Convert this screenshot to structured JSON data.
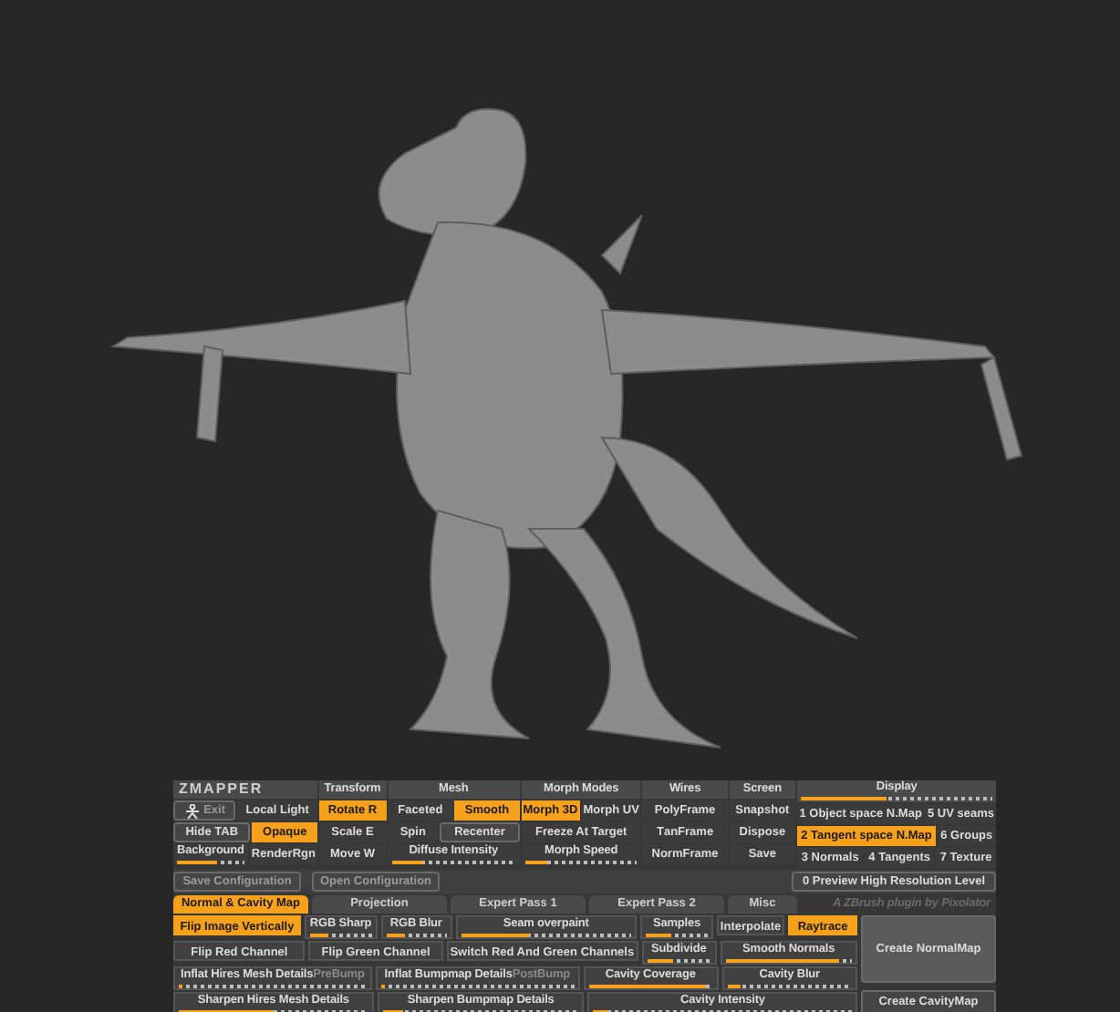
{
  "zmapper": {
    "groups": [
      {
        "header": {
          "kind": "logo",
          "label": "**Z**MAPPER"
        },
        "rows": [
          {
            "controls": [
              {
                "kind": "icon_action",
                "label": "Exit"
              },
              {
                "kind": "toggle",
                "label": "Local Light",
                "selected": false
              }
            ]
          },
          {
            "controls": [
              {
                "kind": "action",
                "label": "Hide **TAB**"
              },
              {
                "kind": "toggle",
                "label": "Opaque",
                "selected": true
              }
            ]
          },
          {
            "controls": [
              {
                "kind": "slider",
                "label": "Background",
                "level": 0.6
              },
              {
                "kind": "toggle",
                "label": "RenderRgn",
                "selected": false
              }
            ]
          }
        ]
      },
      {
        "header": {
          "kind": "tab",
          "label": "Transform"
        },
        "rows": [
          {
            "controls": [
              {
                "kind": "toggle",
                "label": "Rotate **R**",
                "selected": true
              }
            ]
          },
          {
            "controls": [
              {
                "kind": "toggle",
                "label": "Scale **E**",
                "selected": false
              }
            ]
          },
          {
            "controls": [
              {
                "kind": "toggle",
                "label": "Move **W**",
                "selected": false
              }
            ]
          }
        ]
      },
      {
        "header": {
          "kind": "tab",
          "label": "Mesh"
        },
        "rows": [
          {
            "controls": [
              {
                "kind": "toggle",
                "label": "Facete**d**",
                "selected": false
              },
              {
                "kind": "toggle",
                "label": "Smooth",
                "selected": true
              }
            ]
          },
          {
            "controls": [
              {
                "kind": "toggle",
                "label": "Spin",
                "selected": false
              },
              {
                "kind": "action",
                "label": "Recen**t**er"
              }
            ]
          },
          {
            "controls": [
              {
                "kind": "slider",
                "label": "Diffuse Intensity",
                "level": 0.25
              }
            ]
          }
        ]
      },
      {
        "header": {
          "kind": "tab",
          "label": "Morph Modes"
        },
        "rows": [
          {
            "controls": [
              {
                "kind": "toggle",
                "label": "Morph 3D",
                "selected": true
              },
              {
                "kind": "toggle",
                "label": "Morph **UV**",
                "selected": false
              }
            ]
          },
          {
            "controls": [
              {
                "kind": "toggle",
                "label": "Free**z**e At Target",
                "selected": false
              }
            ]
          },
          {
            "controls": [
              {
                "kind": "slider",
                "label": "Morph Speed",
                "level": 0.2
              }
            ]
          }
        ]
      },
      {
        "header": {
          "kind": "tab",
          "label": "Wires"
        },
        "rows": [
          {
            "controls": [
              {
                "kind": "toggle",
                "label": "Poly**F**rame",
                "selected": false
              }
            ]
          },
          {
            "controls": [
              {
                "kind": "toggle",
                "label": "T**a**nFrame",
                "selected": false
              }
            ]
          },
          {
            "controls": [
              {
                "kind": "toggle",
                "label": "Norm**F**rame",
                "selected": false
              }
            ]
          }
        ]
      },
      {
        "header": {
          "kind": "tab",
          "label": "Screen"
        },
        "rows": [
          {
            "controls": [
              {
                "kind": "toggle",
                "label": "**S**napshot",
                "selected": false
              }
            ]
          },
          {
            "controls": [
              {
                "kind": "toggle",
                "label": "**D**ispose",
                "selected": false
              }
            ]
          },
          {
            "controls": [
              {
                "kind": "toggle",
                "label": "Save",
                "selected": false
              }
            ]
          }
        ]
      },
      {
        "header": {
          "kind": "slider",
          "label": "Display",
          "level": 0.45
        },
        "rows": [
          {
            "controls": [
              {
                "kind": "toggle",
                "label": "**1** Object space N.Map",
                "selected": false
              },
              {
                "kind": "toggle",
                "label": "**5** UV seams",
                "selected": false
              }
            ]
          },
          {
            "controls": [
              {
                "kind": "toggle",
                "label": "**2** Tangent space N.Map",
                "selected": true
              },
              {
                "kind": "toggle",
                "label": "**6** Groups",
                "selected": false
              }
            ]
          },
          {
            "controls": [
              {
                "kind": "toggle",
                "label": "**3** Normals",
                "selected": false
              },
              {
                "kind": "toggle",
                "label": "**4** Tangents",
                "selected": false
              },
              {
                "kind": "toggle",
                "label": "**7** Texture",
                "selected": false
              }
            ]
          }
        ]
      }
    ],
    "config_buttons": [
      "**S**ave Configuration",
      "**O**pen Configuration"
    ],
    "preview": {
      "label": "**0** Preview High Resolution Level",
      "selected": false
    },
    "tabs": [
      {
        "label": "Normal & Cavity Map",
        "selected": true
      },
      {
        "label": "Projection",
        "selected": false
      },
      {
        "label": "Expert Pass 1",
        "selected": false
      },
      {
        "label": "Expert Pass 2",
        "selected": false
      },
      {
        "label": "Misc",
        "selected": false
      }
    ],
    "credit": "A ZBrush plugin by Pixolator",
    "rows": [
      {
        "controls": [
          {
            "kind": "toggle",
            "label": "Flip Image Vertically",
            "selected": true
          },
          {
            "kind": "slider",
            "label": "RGB Sharp",
            "level": 0.3
          },
          {
            "kind": "slider",
            "label": "RGB Blur",
            "level": 0.3
          },
          {
            "kind": "slider",
            "label": "Seam overpaint",
            "level": 0.4
          },
          {
            "kind": "slider",
            "label": "Samples",
            "level": 0.4
          },
          {
            "kind": "toggle",
            "label": "Interpolate",
            "selected": false
          },
          {
            "kind": "toggle",
            "label": "Raytrace",
            "selected": true
          }
        ]
      },
      {
        "controls": [
          {
            "kind": "toggle",
            "label": "Flip Red Channel",
            "selected": false
          },
          {
            "kind": "toggle",
            "label": "Flip Green Channel",
            "selected": false
          },
          {
            "kind": "toggle",
            "label": "Switch Red And Green Channels",
            "selected": false
          },
          {
            "kind": "slider",
            "label": "Subdivide",
            "level": 0.4
          },
          {
            "kind": "slider",
            "label": "Smooth Normals",
            "level": 0.9
          }
        ]
      },
      {
        "controls": [
          {
            "kind": "slider",
            "label": "Inflat Hires Mesh Details",
            "suffix": "PreBump",
            "level": 0.02
          },
          {
            "kind": "slider",
            "label": "Inflat Bumpmap Details",
            "suffix": "PostBump",
            "level": 0.02
          },
          {
            "kind": "slider",
            "label": "Cavity Coverage",
            "level": 0.95
          },
          {
            "kind": "slider",
            "label": "Cavity Blur",
            "level": 0.1
          }
        ]
      },
      {
        "controls": [
          {
            "kind": "slider",
            "label": "Sharpen Hires Mesh Details",
            "level": 0.5
          },
          {
            "kind": "slider",
            "label": "Sharpen Bumpmap Details",
            "level": 0.1
          },
          {
            "kind": "slider",
            "label": "Cavity Intensity",
            "level": 0.05
          }
        ]
      }
    ],
    "create_buttons": [
      "**C**reate NormalMap",
      "**C**reate CavityMap"
    ]
  }
}
